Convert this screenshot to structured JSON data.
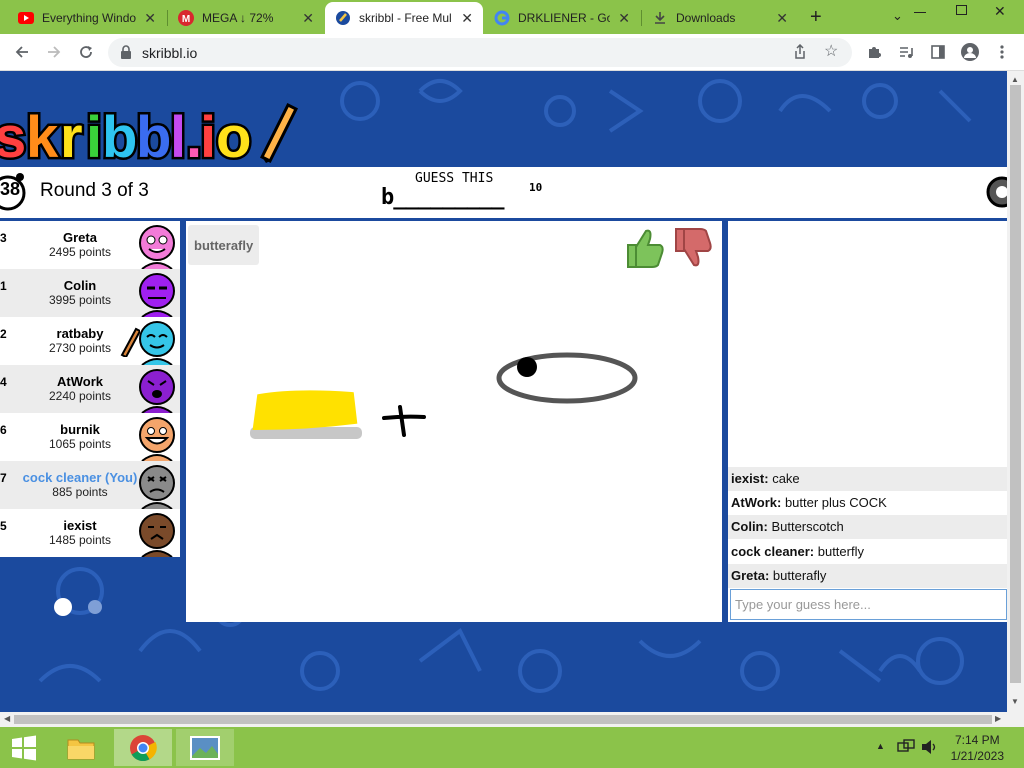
{
  "browser": {
    "tabs": [
      {
        "title": "Everything Windo",
        "icon": "youtube-icon"
      },
      {
        "title": "MEGA ↓ 72%",
        "icon": "mega-icon"
      },
      {
        "title": "skribbl - Free Mul",
        "icon": "skribbl-icon",
        "active": true
      },
      {
        "title": "DRKLIENER - Goo",
        "icon": "google-icon"
      },
      {
        "title": "Downloads",
        "icon": "download-icon"
      }
    ],
    "url": "skribbl.io"
  },
  "game": {
    "logo_text": "skribbl.io",
    "timer": "38",
    "round": "Round 3 of 3",
    "hint_label": "GUESS THIS",
    "word_hint": "b_________",
    "letter_count": "10",
    "canvas_guess_bubble": "butterafly",
    "players": [
      {
        "rank": "3",
        "name": "Greta",
        "points": "2495 points",
        "color": "#f27bd8",
        "you": false
      },
      {
        "rank": "1",
        "name": "Colin",
        "points": "3995 points",
        "color": "#a020f0",
        "you": false
      },
      {
        "rank": "2",
        "name": "ratbaby",
        "points": "2730 points",
        "color": "#35c6e8",
        "you": false
      },
      {
        "rank": "4",
        "name": "AtWork",
        "points": "2240 points",
        "color": "#8b1fd0",
        "you": false
      },
      {
        "rank": "6",
        "name": "burnik",
        "points": "1065 points",
        "color": "#f4a56b",
        "you": false
      },
      {
        "rank": "7",
        "name": "cock cleaner (You)",
        "points": "885 points",
        "color": "#8a8a8a",
        "you": true
      },
      {
        "rank": "5",
        "name": "iexist",
        "points": "1485 points",
        "color": "#7a4a2a",
        "you": false
      }
    ],
    "chat": [
      {
        "name": "iexist:",
        "text": "cake"
      },
      {
        "name": "AtWork:",
        "text": "butter plus COCK"
      },
      {
        "name": "Colin:",
        "text": "Butterscotch"
      },
      {
        "name": "cock cleaner:",
        "text": "butterfly"
      },
      {
        "name": "Greta:",
        "text": "butterafly"
      }
    ],
    "guess_placeholder": "Type your guess here..."
  },
  "taskbar": {
    "time": "7:14 PM",
    "date": "1/21/2023"
  },
  "colors": {
    "tab_strip": "#8bc34a",
    "page_bg": "#1b4a9e",
    "you_name": "#4a90e2"
  }
}
